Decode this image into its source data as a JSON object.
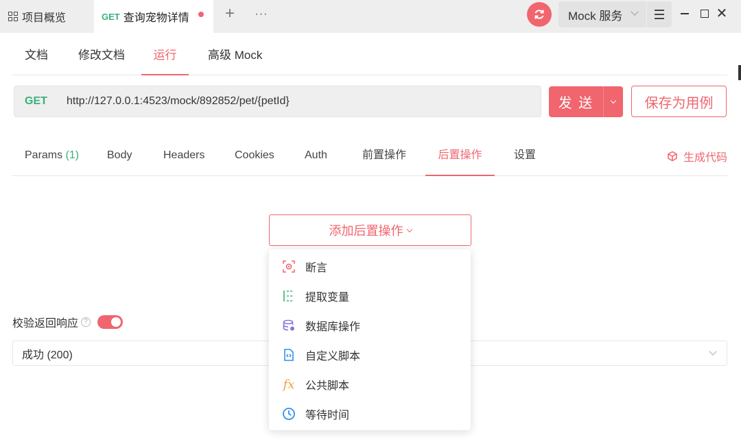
{
  "titlebar": {
    "tabs": [
      {
        "label": "项目概览"
      },
      {
        "method": "GET",
        "label": "查询宠物详情"
      }
    ],
    "add_tab": "+",
    "more": "···",
    "env_label": "Mock 服务"
  },
  "doc_tabs": [
    {
      "label": "文档"
    },
    {
      "label": "修改文档"
    },
    {
      "label": "运行"
    },
    {
      "label": "高级 Mock"
    }
  ],
  "request": {
    "method": "GET",
    "url": "http://127.0.0.1:4523/mock/892852/pet/{petId}",
    "send_label": "发 送",
    "save_label": "保存为用例"
  },
  "req_tabs": {
    "params_label": "Params",
    "params_count": "(1)",
    "items": [
      {
        "label": "Body"
      },
      {
        "label": "Headers"
      },
      {
        "label": "Cookies"
      },
      {
        "label": "Auth"
      },
      {
        "label": "前置操作"
      },
      {
        "label": "后置操作"
      },
      {
        "label": "设置"
      }
    ],
    "generate_code": "生成代码"
  },
  "post_ops": {
    "add_button": "添加后置操作",
    "menu": [
      {
        "label": "断言",
        "icon": "assertion-icon"
      },
      {
        "label": "提取变量",
        "icon": "extract-variable-icon"
      },
      {
        "label": "数据库操作",
        "icon": "database-icon"
      },
      {
        "label": "自定义脚本",
        "icon": "script-file-icon"
      },
      {
        "label": "公共脚本",
        "icon": "fx-icon",
        "glyph": "fx"
      },
      {
        "label": "等待时间",
        "icon": "clock-icon"
      }
    ]
  },
  "validation": {
    "label": "校验返回响应",
    "help": "?",
    "enabled": true,
    "response_option": "成功 (200)"
  },
  "colors": {
    "accent": "#f0656e",
    "get_method": "#3ab07a"
  }
}
